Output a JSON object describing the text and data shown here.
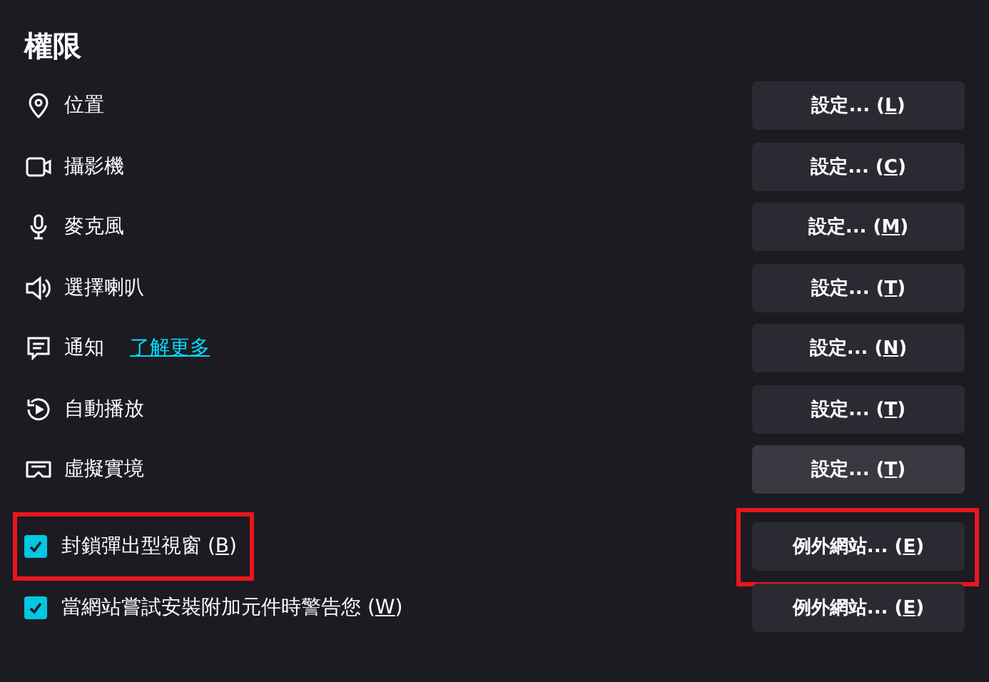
{
  "heading": "權限",
  "permissions": [
    {
      "kind": "location",
      "label": "位置",
      "button": "設定... (L)",
      "hover": false
    },
    {
      "kind": "camera",
      "label": "攝影機",
      "button": "設定... (C)",
      "hover": false
    },
    {
      "kind": "microphone",
      "label": "麥克風",
      "button": "設定... (M)",
      "hover": false
    },
    {
      "kind": "speaker",
      "label": "選擇喇叭",
      "button": "設定... (T)",
      "hover": false
    },
    {
      "kind": "notification",
      "label": "通知",
      "link": "了解更多",
      "button": "設定... (N)",
      "hover": false
    },
    {
      "kind": "autoplay",
      "label": "自動播放",
      "button": "設定... (T)",
      "hover": false
    },
    {
      "kind": "vr",
      "label": "虛擬實境",
      "button": "設定... (T)",
      "hover": true
    }
  ],
  "options": [
    {
      "label": "封鎖彈出型視窗 (B)",
      "checked": true,
      "highlighted": true,
      "button": "例外網站... (E)",
      "button_highlighted": true
    },
    {
      "label": "當網站嘗試安裝附加元件時警告您 (W)",
      "checked": true,
      "highlighted": false,
      "button": "例外網站... (E)",
      "button_highlighted": false
    }
  ]
}
